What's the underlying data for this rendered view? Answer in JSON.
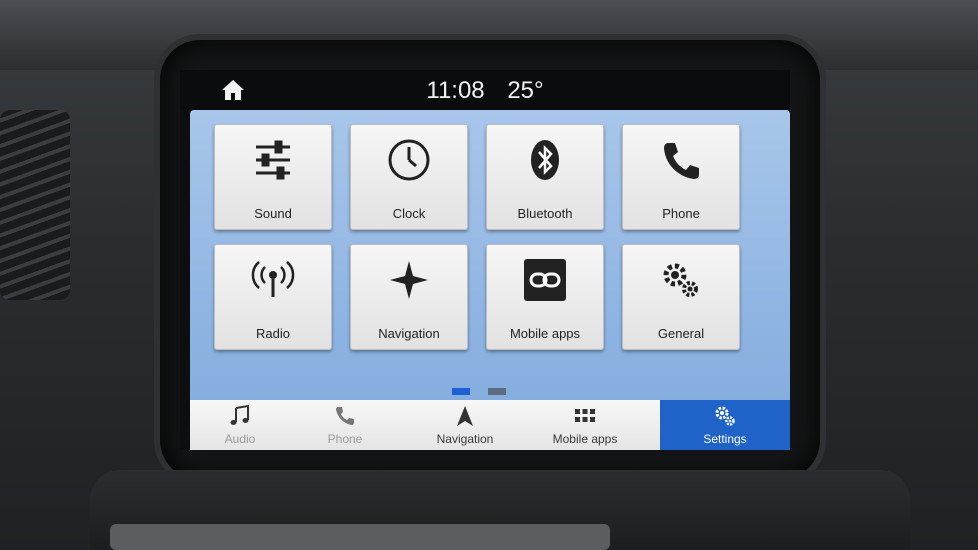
{
  "status_bar": {
    "time": "11:08",
    "temperature": "25°"
  },
  "tiles": [
    {
      "label": "Sound",
      "icon": "sliders-icon"
    },
    {
      "label": "Clock",
      "icon": "clock-icon"
    },
    {
      "label": "Bluetooth",
      "icon": "bluetooth-icon"
    },
    {
      "label": "Phone",
      "icon": "phone-icon"
    },
    {
      "label": "Radio",
      "icon": "radio-antenna-icon"
    },
    {
      "label": "Navigation",
      "icon": "compass-star-icon"
    },
    {
      "label": "Mobile apps",
      "icon": "link-icon"
    },
    {
      "label": "General",
      "icon": "gears-icon"
    }
  ],
  "pagination": {
    "pages": 2,
    "active_page": 1
  },
  "bottom_nav": [
    {
      "label": "Audio",
      "icon": "music-note-icon"
    },
    {
      "label": "Phone",
      "icon": "phone-icon"
    },
    {
      "label": "Navigation",
      "icon": "navigation-arrow-icon"
    },
    {
      "label": "Mobile apps",
      "icon": "grid-icon"
    },
    {
      "label": "Settings",
      "icon": "gears-icon",
      "active": true
    }
  ],
  "colors": {
    "accent": "#1f63c9",
    "screen_bg": "#a8c6ea",
    "statusbar_bg": "#0b0c0e"
  }
}
